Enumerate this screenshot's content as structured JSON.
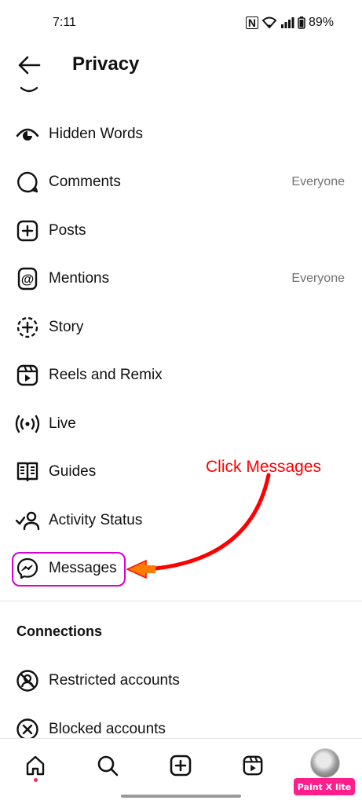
{
  "status_bar": {
    "time": "7:11",
    "nfc": "N",
    "battery": "89%"
  },
  "header": {
    "title": "Privacy"
  },
  "items": [
    {
      "label": "Hidden Words",
      "value": "",
      "icon": "eye-icon"
    },
    {
      "label": "Comments",
      "value": "Everyone",
      "icon": "comment-bubble-icon"
    },
    {
      "label": "Posts",
      "value": "",
      "icon": "plus-square-icon"
    },
    {
      "label": "Mentions",
      "value": "Everyone",
      "icon": "at-sign-icon"
    },
    {
      "label": "Story",
      "value": "",
      "icon": "story-add-icon"
    },
    {
      "label": "Reels and Remix",
      "value": "",
      "icon": "reels-icon"
    },
    {
      "label": "Live",
      "value": "",
      "icon": "live-broadcast-icon"
    },
    {
      "label": "Guides",
      "value": "",
      "icon": "guides-book-icon"
    },
    {
      "label": "Activity Status",
      "value": "",
      "icon": "activity-status-icon"
    },
    {
      "label": "Messages",
      "value": "",
      "icon": "messenger-icon"
    }
  ],
  "connections": {
    "title": "Connections",
    "items": [
      {
        "label": "Restricted accounts",
        "icon": "restricted-icon"
      },
      {
        "label": "Blocked accounts",
        "icon": "blocked-icon"
      }
    ]
  },
  "annotation": {
    "text": "Click Messages",
    "color": "#ff0000",
    "highlight_color": "#d400d4"
  },
  "bottom_nav": [
    "home-icon",
    "search-icon",
    "create-icon",
    "reels-icon",
    "profile-avatar"
  ],
  "watermark": "Paint X lite"
}
